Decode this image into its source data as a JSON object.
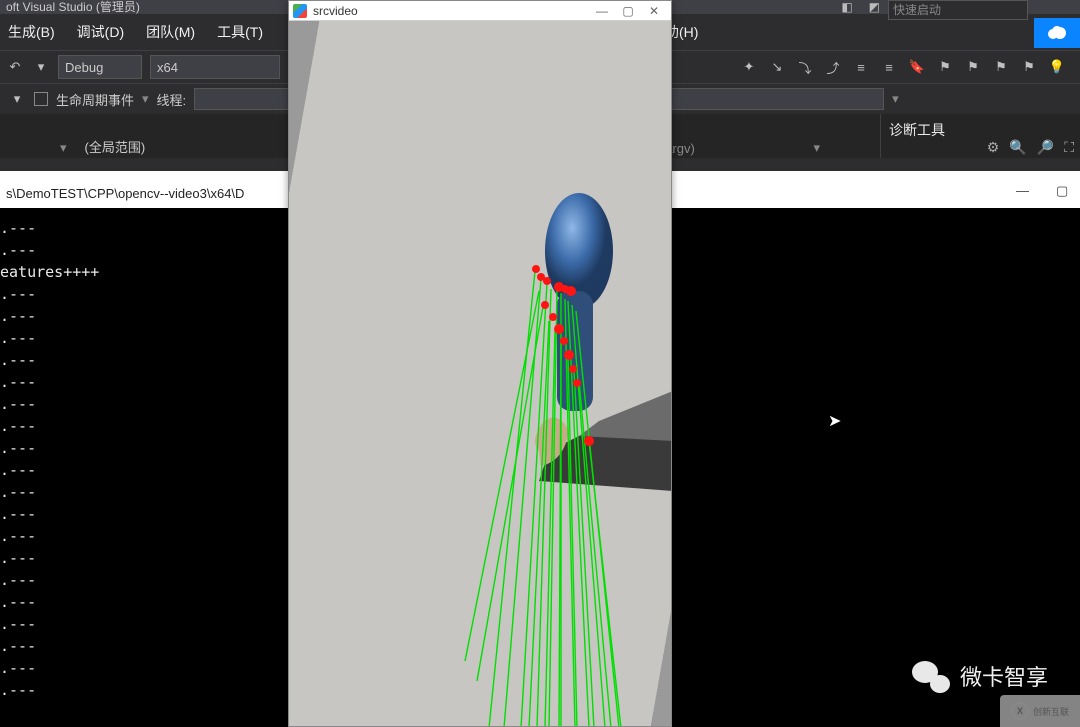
{
  "vs": {
    "title": "oft Visual Studio (管理员)",
    "menu": {
      "build": "生成(B)",
      "debug": "调试(D)",
      "team": "团队(M)",
      "tools": "工具(T)",
      "help": "助(H)"
    },
    "quick_launch": "快速启动",
    "toolbar": {
      "config": "Debug",
      "platform": "x64"
    },
    "toolbar2": {
      "lifecycle": "生命周期事件",
      "thread": "线程:"
    },
    "scope": "(全局范围)",
    "right_dropdown_suffix": "argv)",
    "diagnostics_title": "诊断工具"
  },
  "console": {
    "path": "s\\DemoTEST\\CPP\\opencv--video3\\x64\\D",
    "line_marker": ".---",
    "features": "eatures++++"
  },
  "cv": {
    "title": "srcvideo"
  },
  "watermark": {
    "wechat_name": "微卡智享",
    "corner": "创新互联"
  }
}
